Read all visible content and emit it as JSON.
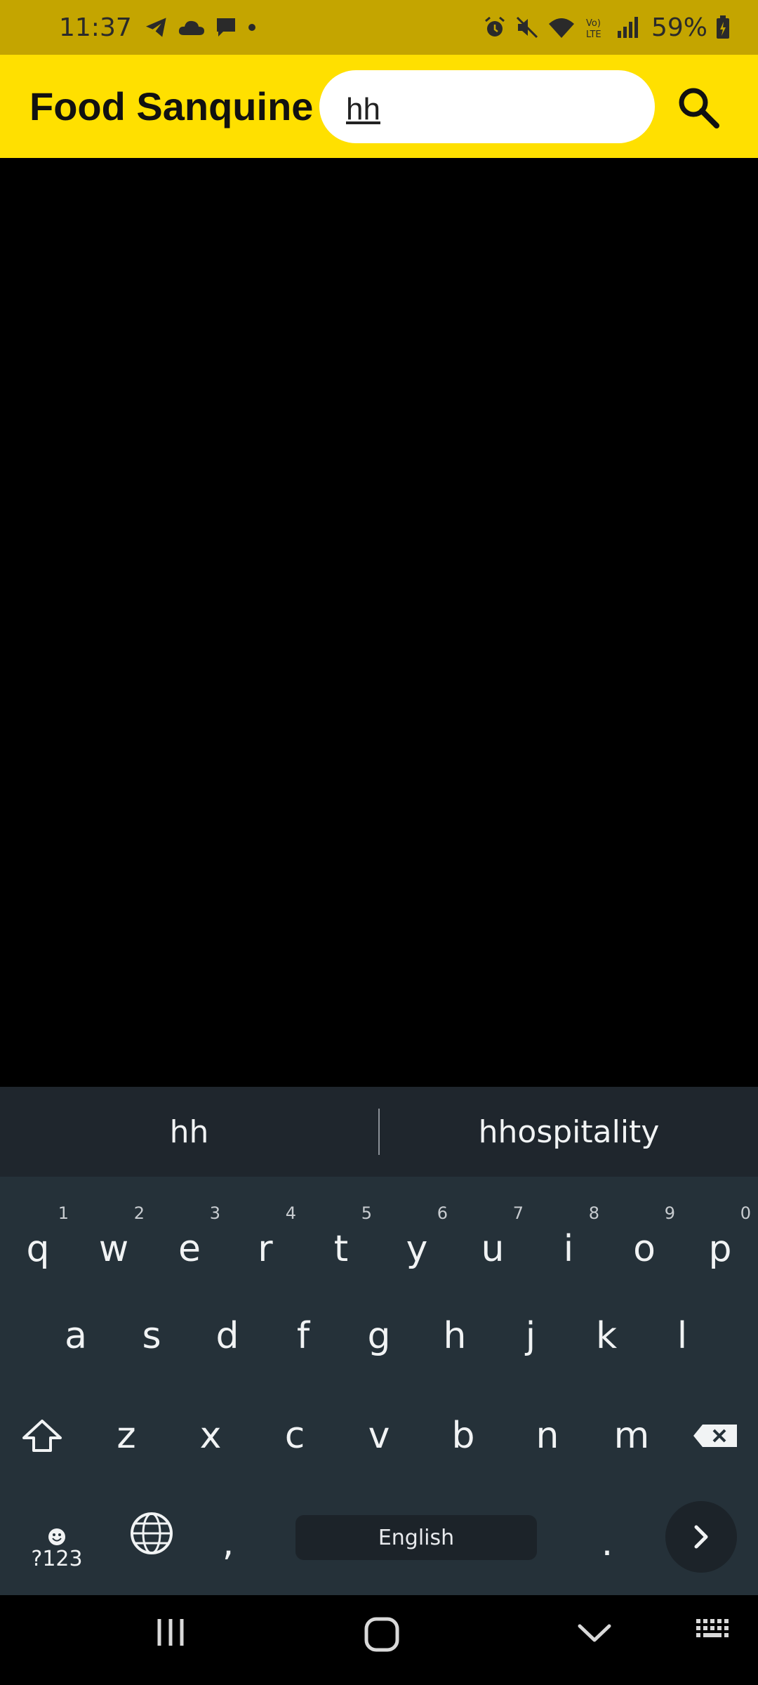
{
  "status_bar": {
    "time": "11:37",
    "battery_percent": "59%",
    "left_icons": [
      "telegram-icon",
      "cloud-icon",
      "chat-icon",
      "dot-icon"
    ],
    "right_icons": [
      "alarm-icon",
      "mute-icon",
      "wifi-icon",
      "volte-icon",
      "signal-icon",
      "battery-icon"
    ]
  },
  "app_bar": {
    "title": "Food Sanquine",
    "search_value": "hh",
    "search_icon": "search-icon",
    "background_color": "#ffe000"
  },
  "keyboard": {
    "suggestions": [
      "hh",
      "hhospitality"
    ],
    "row1": [
      {
        "key": "q",
        "hint": "1"
      },
      {
        "key": "w",
        "hint": "2"
      },
      {
        "key": "e",
        "hint": "3"
      },
      {
        "key": "r",
        "hint": "4"
      },
      {
        "key": "t",
        "hint": "5"
      },
      {
        "key": "y",
        "hint": "6"
      },
      {
        "key": "u",
        "hint": "7"
      },
      {
        "key": "i",
        "hint": "8"
      },
      {
        "key": "o",
        "hint": "9"
      },
      {
        "key": "p",
        "hint": "0"
      }
    ],
    "row2": [
      "a",
      "s",
      "d",
      "f",
      "g",
      "h",
      "j",
      "k",
      "l"
    ],
    "row3": [
      "z",
      "x",
      "c",
      "v",
      "b",
      "n",
      "m"
    ],
    "symbols_label": "?123",
    "comma": ",",
    "period": ".",
    "space_label": "English"
  },
  "nav_bar": {
    "buttons": [
      "recents-icon",
      "home-icon",
      "back-icon",
      "keyboard-icon"
    ]
  }
}
